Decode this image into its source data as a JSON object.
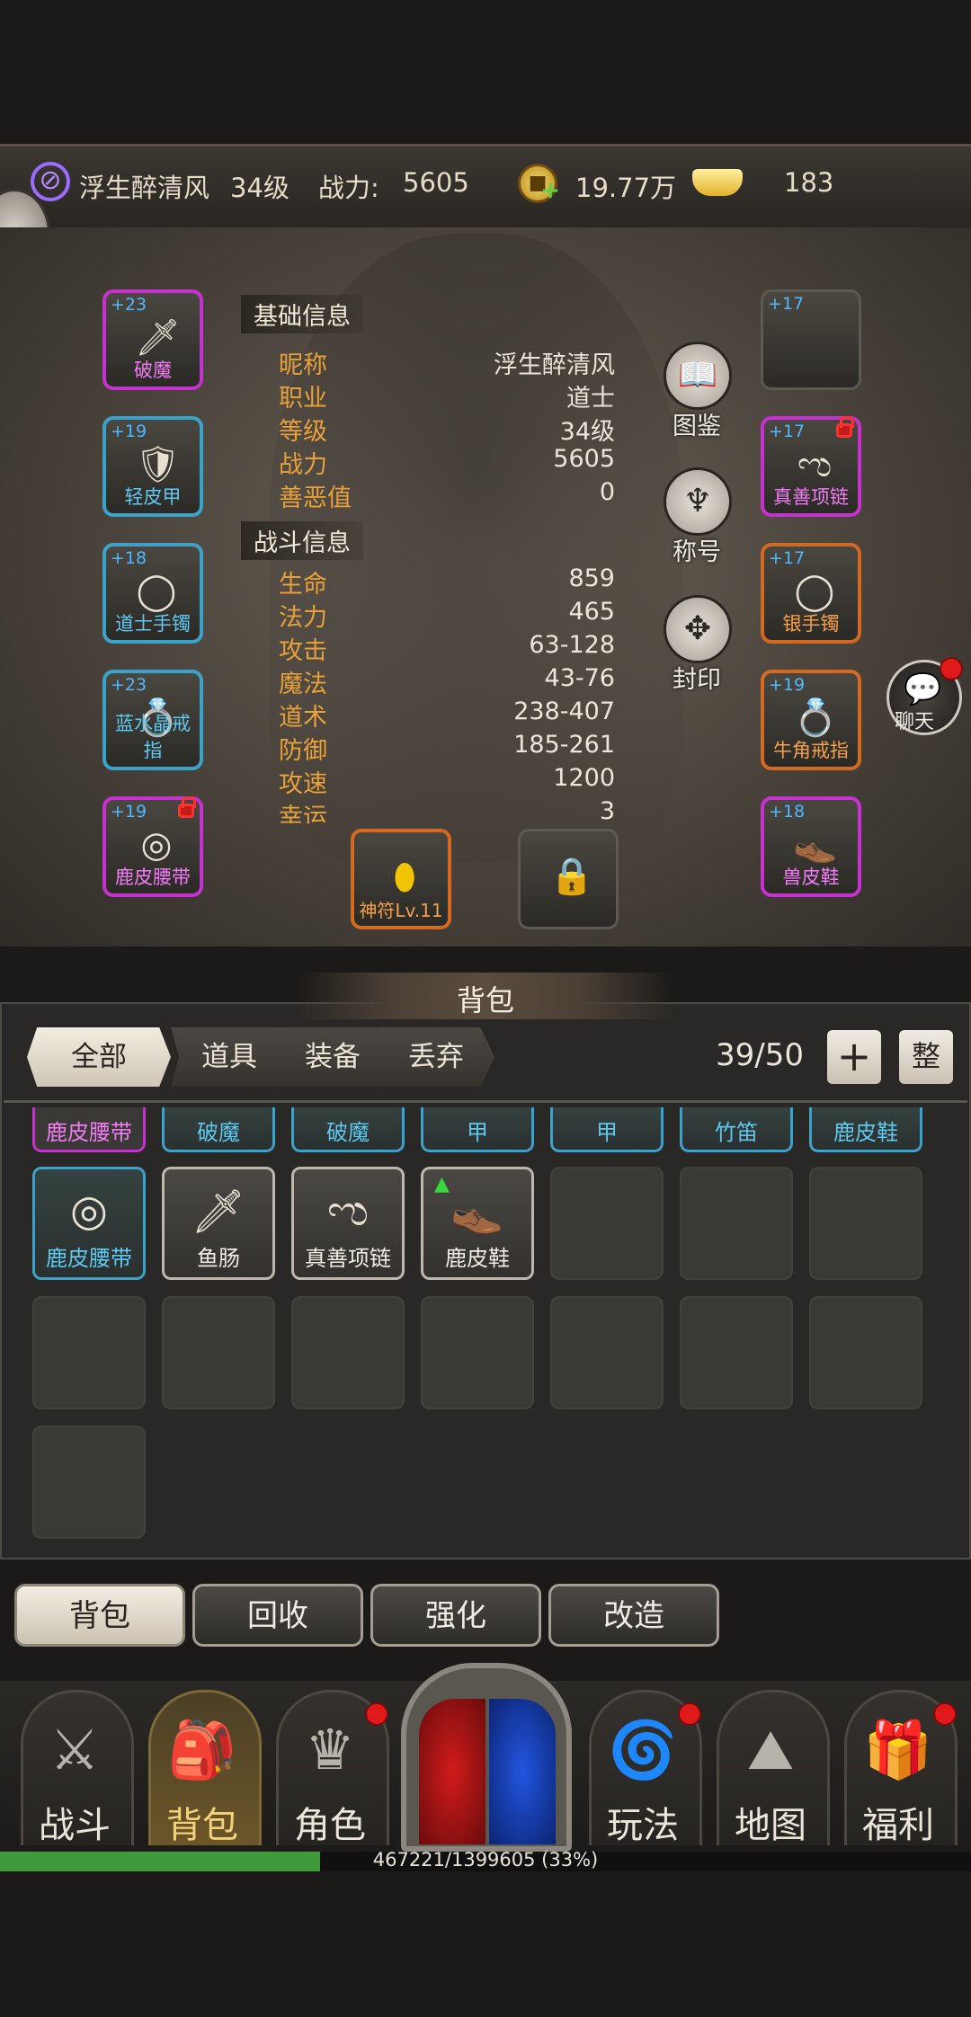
{
  "header": {
    "player_name": "浮生醉清风",
    "level": "34级",
    "power_label": "战力:",
    "power_value": "5605",
    "coins": "19.77万",
    "gold": "183"
  },
  "equip_left": [
    {
      "plus": "+23",
      "name": "破魔",
      "quality": "purple",
      "icon": "sword-icon"
    },
    {
      "plus": "+19",
      "name": "轻皮甲",
      "quality": "blue",
      "icon": "armor-icon"
    },
    {
      "plus": "+18",
      "name": "道士手镯",
      "quality": "blue",
      "icon": "bracelet-icon"
    },
    {
      "plus": "+23",
      "name": "蓝水晶戒指",
      "quality": "blue",
      "icon": "ring-icon"
    },
    {
      "plus": "+19",
      "name": "鹿皮腰带",
      "quality": "purple",
      "icon": "belt-icon",
      "locked": true
    }
  ],
  "equip_right": [
    {
      "plus": "+17",
      "name": "",
      "quality": "gray",
      "icon": "helmet-placeholder-icon"
    },
    {
      "plus": "+17",
      "name": "真善项链",
      "quality": "purple",
      "icon": "necklace-icon",
      "locked": true
    },
    {
      "plus": "+17",
      "name": "银手镯",
      "quality": "orange",
      "icon": "bracelet-icon"
    },
    {
      "plus": "+19",
      "name": "牛角戒指",
      "quality": "orange",
      "icon": "ring-icon"
    },
    {
      "plus": "+18",
      "name": "兽皮鞋",
      "quality": "purple",
      "icon": "boots-icon"
    }
  ],
  "basic_info": {
    "title": "基础信息",
    "rows": [
      {
        "label": "昵称",
        "value": "浮生醉清风"
      },
      {
        "label": "职业",
        "value": "道士"
      },
      {
        "label": "等级",
        "value": "34级"
      },
      {
        "label": "战力",
        "value": "5605"
      },
      {
        "label": "善恶值",
        "value": "0"
      }
    ]
  },
  "battle_info": {
    "title": "战斗信息",
    "rows": [
      {
        "label": "生命",
        "value": "859"
      },
      {
        "label": "法力",
        "value": "465"
      },
      {
        "label": "攻击",
        "value": "63-128"
      },
      {
        "label": "魔法",
        "value": "43-76"
      },
      {
        "label": "道术",
        "value": "238-407"
      },
      {
        "label": "防御",
        "value": "185-261"
      },
      {
        "label": "攻速",
        "value": "1200"
      },
      {
        "label": "幸运",
        "value": "3"
      }
    ]
  },
  "side_buttons": {
    "codex": "图鉴",
    "title": "称号",
    "seal": "封印"
  },
  "talisman": "神符Lv.11",
  "chat": "聊天",
  "bag": {
    "title": "背包",
    "tabs": [
      "全部",
      "道具",
      "装备",
      "丢弃"
    ],
    "capacity": "39/50",
    "add": "+",
    "sort": "整",
    "row_cut": [
      {
        "name": "鹿皮腰带",
        "quality": "purple"
      },
      {
        "name": "破魔",
        "quality": "blue"
      },
      {
        "name": "破魔",
        "quality": "blue"
      },
      {
        "name": "甲",
        "quality": "blue"
      },
      {
        "name": "甲",
        "quality": "blue"
      },
      {
        "name": "竹笛",
        "quality": "blue"
      },
      {
        "name": "鹿皮鞋",
        "quality": "blue"
      }
    ],
    "row_items": [
      {
        "name": "鹿皮腰带",
        "quality": "blue",
        "icon": "belt-icon"
      },
      {
        "name": "鱼肠",
        "quality": "gray",
        "icon": "sword-icon"
      },
      {
        "name": "真善项链",
        "quality": "gray",
        "icon": "necklace-icon"
      },
      {
        "name": "鹿皮鞋",
        "quality": "gray",
        "icon": "boots-icon",
        "upgrade": true
      }
    ]
  },
  "sub_buttons": [
    "背包",
    "回收",
    "强化",
    "改造"
  ],
  "nav": [
    "战斗",
    "背包",
    "角色",
    "玩法",
    "地图",
    "福利"
  ],
  "exp": {
    "text": "467221/1399605 (33%)",
    "fraction": 0.33
  }
}
